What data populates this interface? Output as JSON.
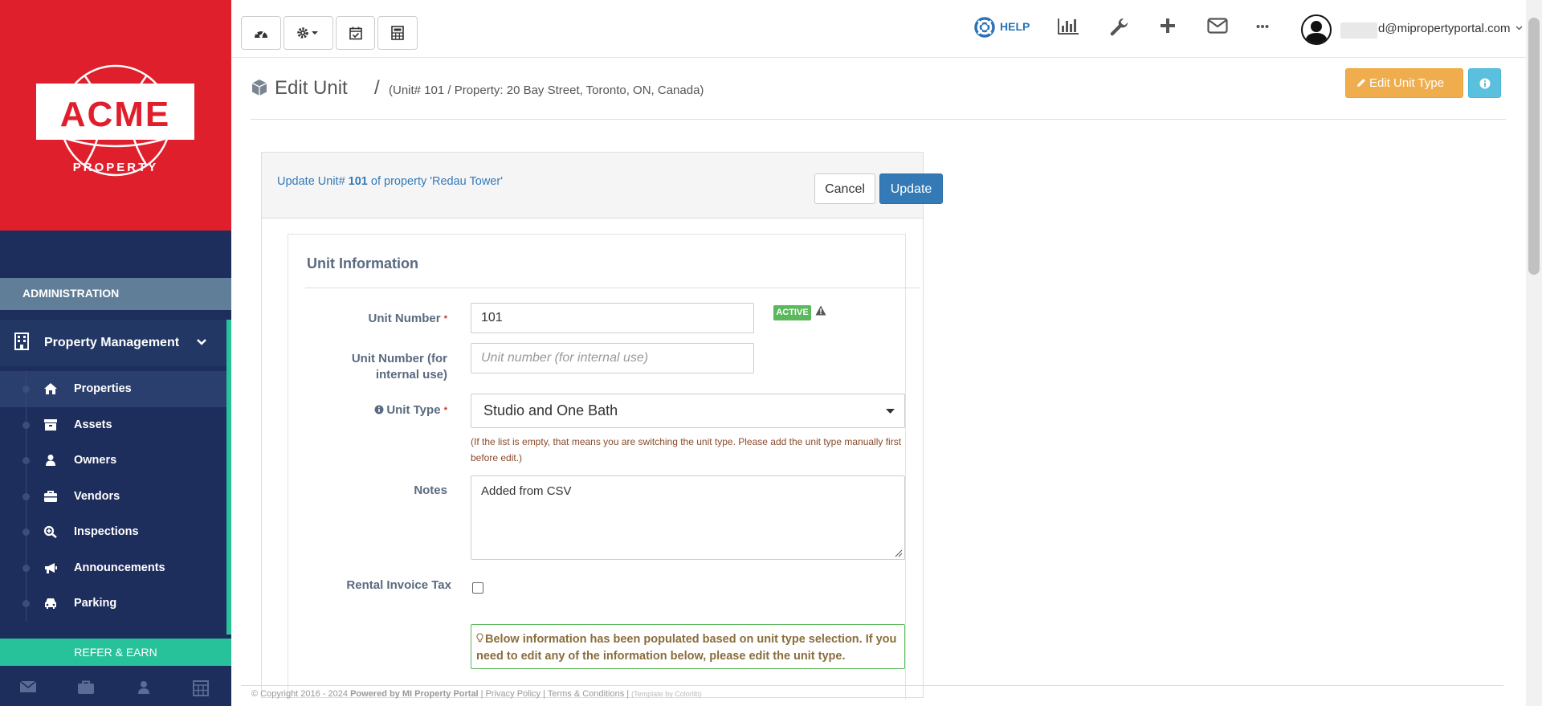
{
  "sidebar": {
    "logo_text": "ACME",
    "logo_sub": "PROPERTY",
    "admin_label": "ADMINISTRATION",
    "section_label": "Property Management",
    "items": [
      {
        "label": "Properties",
        "icon": "home-icon"
      },
      {
        "label": "Assets",
        "icon": "archive-icon"
      },
      {
        "label": "Owners",
        "icon": "user-icon"
      },
      {
        "label": "Vendors",
        "icon": "briefcase-icon"
      },
      {
        "label": "Inspections",
        "icon": "search-plus-icon"
      },
      {
        "label": "Announcements",
        "icon": "bullhorn-icon"
      },
      {
        "label": "Parking",
        "icon": "car-icon"
      }
    ],
    "refer_label": "REFER & EARN",
    "bottom_icons": [
      "envelope-icon",
      "briefcase-icon",
      "user-icon",
      "calculator-icon"
    ]
  },
  "topbar": {
    "left_buttons": [
      "dashboard-icon",
      "gear-icon",
      "calendar-check-icon",
      "calculator-icon"
    ],
    "help_label": "HELP",
    "right_icons": [
      "bar-chart-icon",
      "wrench-icon",
      "plus-icon",
      "envelope-icon",
      "more-icon"
    ],
    "user_email": "d@mipropertyportal.com"
  },
  "page": {
    "title": "Edit Unit",
    "separator": "/",
    "breadcrumb": "(Unit# 101 / Property: 20 Bay Street, Toronto, ON, Canada)",
    "edit_unit_type_label": "Edit Unit Type"
  },
  "panel": {
    "heading_prefix": "Update Unit# ",
    "heading_unit": "101",
    "heading_suffix": " of property 'Redau Tower'",
    "cancel_label": "Cancel",
    "update_label": "Update"
  },
  "form": {
    "section_title": "Unit Information",
    "unit_number_label": "Unit Number",
    "unit_number_value": "101",
    "status_badge": "ACTIVE",
    "internal_label": "Unit Number (for internal use)",
    "internal_placeholder": "Unit number (for internal use)",
    "unit_type_label": "Unit Type",
    "unit_type_value": "Studio and One Bath",
    "unit_type_help": "(If the list is empty, that means you are switching the unit type. Please add the unit type manually first before edit.)",
    "notes_label": "Notes",
    "notes_value": "Added from CSV",
    "tax_label": "Rental Invoice Tax",
    "tax_checked": false,
    "alert_text": "Below information has been populated based on unit type selection. If you need to edit any of the information below, please edit the unit type."
  },
  "footer": {
    "copyright": "© Copyright 2016 - 2024 ",
    "powered": "Powered by MI Property Portal",
    "links": " | Privacy Policy | Terms & Conditions | ",
    "template": "(Template by Colorlib)"
  },
  "colors": {
    "brand_red": "#e01f2d",
    "sidebar_navy": "#1d2d5c",
    "accent_teal": "#28c29a",
    "primary_blue": "#337ab7",
    "warning_orange": "#f0ad4e",
    "info_cyan": "#5bc0de",
    "success_green": "#5cb85c"
  }
}
